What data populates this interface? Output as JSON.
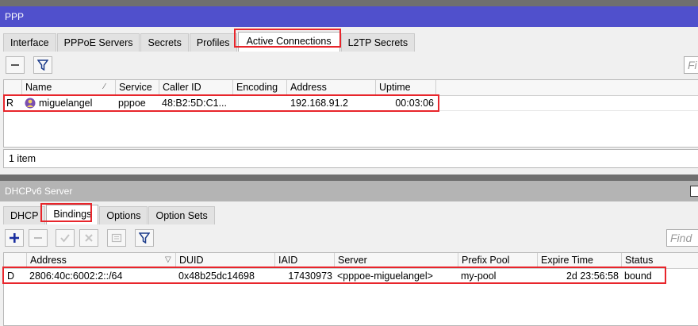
{
  "ppp": {
    "title": "PPP",
    "tabs": [
      "Interface",
      "PPPoE Servers",
      "Secrets",
      "Profiles",
      "Active Connections",
      "L2TP Secrets"
    ],
    "find_placeholder": "Fi",
    "columns": [
      "",
      "Name",
      "Service",
      "Caller ID",
      "Encoding",
      "Address",
      "Uptime"
    ],
    "row": {
      "flag": "R",
      "name": "miguelangel",
      "service": "pppoe",
      "caller_id": "48:B2:5D:C1...",
      "encoding": "",
      "address": "192.168.91.2",
      "uptime": "00:03:06"
    },
    "item_count": "1 item"
  },
  "dhcpv6": {
    "title": "DHCPv6 Server",
    "tabs": [
      "DHCP",
      "Bindings",
      "Options",
      "Option Sets"
    ],
    "find_placeholder": "Find",
    "columns": [
      "",
      "Address",
      "DUID",
      "IAID",
      "Server",
      "Prefix Pool",
      "Expire Time",
      "Status"
    ],
    "row": {
      "flag": "D",
      "address": "2806:40c:6002:2::/64",
      "duid": "0x48b25dc14698",
      "iaid": "17430973",
      "server": "<pppoe-miguelangel>",
      "prefix_pool": "my-pool",
      "expire_time": "2d 23:56:58",
      "status": "bound"
    }
  },
  "colors": {
    "highlight": "#e8252b",
    "active_title": "#5050cc",
    "inactive_title": "#b4b4b4"
  },
  "icons": [
    "minus-icon",
    "filter-icon",
    "user-icon",
    "plus-icon",
    "check-icon",
    "cross-icon",
    "comment-icon"
  ]
}
